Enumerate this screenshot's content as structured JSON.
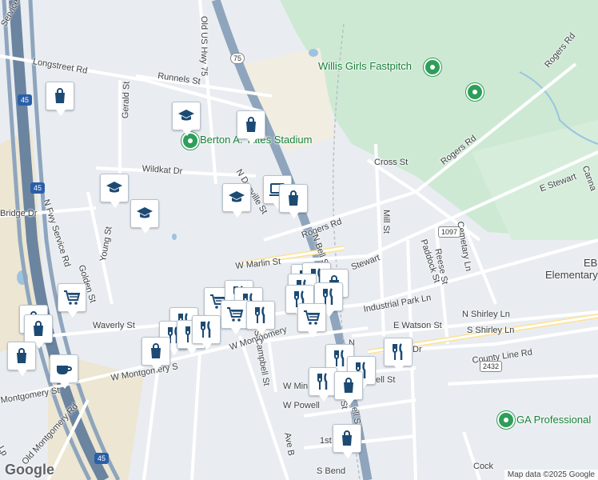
{
  "streets": {
    "n_fwy_service_rd": "N Fwy Service Rd",
    "service_rd_top": "Service Rd",
    "longstreet_rd": "Longstreet Rd",
    "runnels_st": "Runnels St",
    "old_us_hwy_75": "Old US Hwy 75",
    "gerald_st": "Gerald St",
    "wildkat_dr": "Wildkat Dr",
    "bridge_dr": "Bridge Dr",
    "young_st": "Young St",
    "golden_st": "Golden St",
    "waverly_st": "Waverly St",
    "n_danville_st": "N Danville St",
    "rogers_rd": "Rogers Rd",
    "rogers_rd_ne": "Rogers Rd",
    "rogers_rd_top": "Rogers Rd",
    "cross_st": "Cross St",
    "mill_st": "Mill St",
    "n_bell_st": "N Bell St",
    "w_marlin_st": "W Marlin St",
    "e_stewart_partial": "Stewart",
    "e_stewart": "E Stewart",
    "industrial_park_ln": "Industrial Park Ln",
    "reese_st": "Reese St",
    "paddock_st": "Paddock St",
    "cemetary_ln": "Cemetary Ln",
    "n_shirley_ln": "N Shirley Ln",
    "s_shirley_ln": "S Shirley Ln",
    "e_watson_st": "E Watson St",
    "county_line_rd": "County Line Rd",
    "w_montgomery": "W Montgomery",
    "w_montgomery_s": "W Montgomery S",
    "montgomery_st": "Montgomery St",
    "s_campbell_st": "S Campbell St",
    "w_min": "W Min",
    "w_powell": "W Powell",
    "ave_b": "Ave B",
    "first": "1st",
    "s_bend": "S Bend",
    "old_montgomery_rd": "Old Montgomery Rd",
    "e_lp": "e Lp",
    "cannon_partial": "Canna",
    "cock_partial": "Cock",
    "dr_partial": "Dr",
    "ell_st": "ell St",
    "st_partial": "St",
    "bell_st_lower": "ell St",
    "n_partial": "N"
  },
  "places": {
    "willis_girls_fastpitch": "Willis Girls Fastpitch",
    "berton_stadium": "Berton A. Yates Stadium",
    "eb_elementary": "EB",
    "eb_elementary_2": "Elementary",
    "ga_professional": "GA Professional"
  },
  "shields": {
    "hwy_75": "75",
    "i45_a": "45",
    "i45_b": "45",
    "i45_c": "45",
    "fm_1097": "1097",
    "fm_2432": "2432"
  },
  "branding": {
    "logo": "Google",
    "attribution": "Map data ©2025 Google"
  },
  "colors": {
    "park": "#cde9d3",
    "highway": "#8fa5bd",
    "interstate": "#6b84a0",
    "marker_icon": "#1c4a73",
    "poi_green": "#188038"
  }
}
